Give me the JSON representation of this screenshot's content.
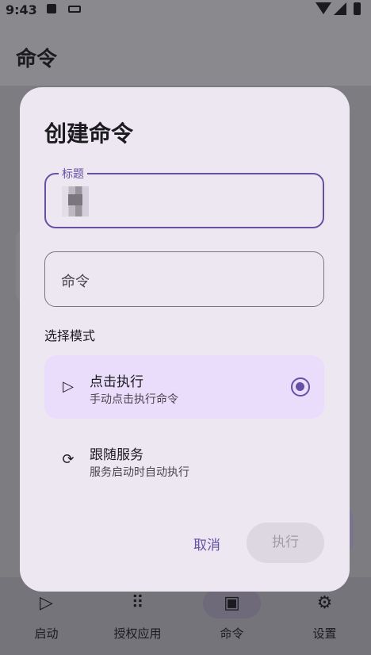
{
  "status": {
    "time": "9:43"
  },
  "app": {
    "title": "命令"
  },
  "nav": {
    "items": [
      {
        "label": "启动",
        "icon": "play-icon",
        "glyph": "▷"
      },
      {
        "label": "授权应用",
        "icon": "apps-grid-icon",
        "glyph": "⠿"
      },
      {
        "label": "命令",
        "icon": "terminal-icon",
        "glyph": "▣"
      },
      {
        "label": "设置",
        "icon": "gear-icon",
        "glyph": "⚙"
      }
    ],
    "active_index": 2
  },
  "dialog": {
    "title": "创建命令",
    "title_field": {
      "label": "标题",
      "value": ""
    },
    "command_field": {
      "placeholder": "命令"
    },
    "mode_label": "选择模式",
    "options": [
      {
        "title": "点击执行",
        "subtitle": "手动点击执行命令",
        "icon": "play-icon",
        "glyph": "▷",
        "selected": true
      },
      {
        "title": "跟随服务",
        "subtitle": "服务启动时自动执行",
        "icon": "sync-icon",
        "glyph": "⟳",
        "selected": false
      }
    ],
    "cancel_label": "取消",
    "execute_label": "执行"
  },
  "colors": {
    "accent": "#6750a4",
    "dialog_bg": "#ede7f2",
    "selected_option_bg": "#e9ddfb",
    "disabled_button_bg": "#dcd7e0"
  }
}
